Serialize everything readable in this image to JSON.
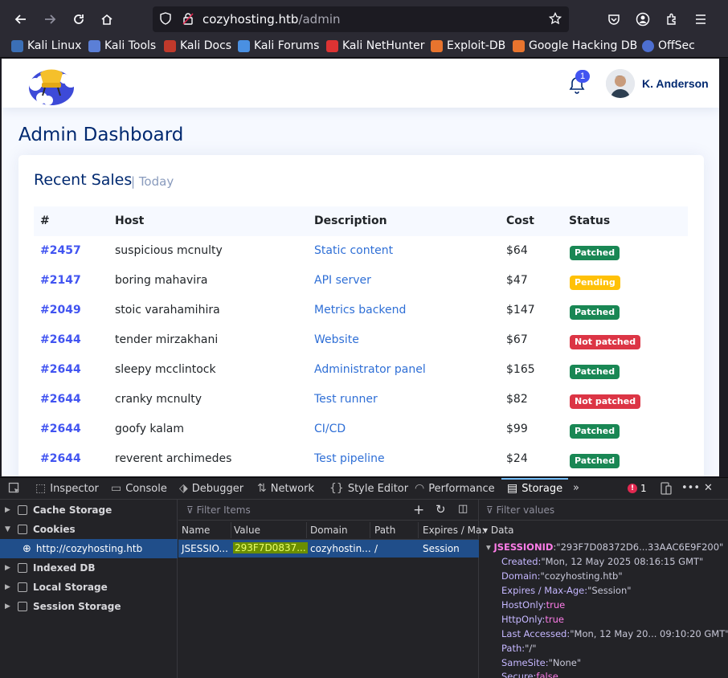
{
  "browser": {
    "url_host": "cozyhosting.htb",
    "url_path": "/admin",
    "bookmarks": [
      "Kali Linux",
      "Kali Tools",
      "Kali Docs",
      "Kali Forums",
      "Kali NetHunter",
      "Exploit-DB",
      "Google Hacking DB",
      "OffSec"
    ]
  },
  "header": {
    "notification_count": "1",
    "user_name": "K. Anderson"
  },
  "page": {
    "title": "Admin Dashboard",
    "card_title": "Recent Sales",
    "card_subtitle": "| Today",
    "columns": [
      "#",
      "Host",
      "Description",
      "Cost",
      "Status"
    ],
    "rows": [
      {
        "id": "#2457",
        "host": "suspicious mcnulty",
        "desc": "Static content",
        "cost": "$64",
        "status": "Patched",
        "kind": "patched"
      },
      {
        "id": "#2147",
        "host": "boring mahavira",
        "desc": "API server",
        "cost": "$47",
        "status": "Pending",
        "kind": "pending"
      },
      {
        "id": "#2049",
        "host": "stoic varahamihira",
        "desc": "Metrics backend",
        "cost": "$147",
        "status": "Patched",
        "kind": "patched"
      },
      {
        "id": "#2644",
        "host": "tender mirzakhani",
        "desc": "Website",
        "cost": "$67",
        "status": "Not patched",
        "kind": "notpatched"
      },
      {
        "id": "#2644",
        "host": "sleepy mcclintock",
        "desc": "Administrator panel",
        "cost": "$165",
        "status": "Patched",
        "kind": "patched"
      },
      {
        "id": "#2644",
        "host": "cranky mcnulty",
        "desc": "Test runner",
        "cost": "$82",
        "status": "Not patched",
        "kind": "notpatched"
      },
      {
        "id": "#2644",
        "host": "goofy kalam",
        "desc": "CI/CD",
        "cost": "$99",
        "status": "Patched",
        "kind": "patched"
      },
      {
        "id": "#2644",
        "host": "reverent archimedes",
        "desc": "Test pipeline",
        "cost": "$24",
        "status": "Patched",
        "kind": "patched"
      }
    ],
    "colors": {
      "patched": "#198754",
      "pending": "#ffc107",
      "notpatched": "#dc3545",
      "accent": "#4154f1",
      "title": "#012970"
    }
  },
  "devtools": {
    "tabs": [
      "Inspector",
      "Console",
      "Debugger",
      "Network",
      "Style Editor",
      "Performance",
      "Storage"
    ],
    "active_tab": "Storage",
    "error_count": "1",
    "tree": {
      "cache_storage": "Cache Storage",
      "cookies": "Cookies",
      "cookie_host": "http://cozyhosting.htb",
      "indexed_db": "Indexed DB",
      "local_storage": "Local Storage",
      "session_storage": "Session Storage"
    },
    "filter_items": "Filter Items",
    "filter_values": "Filter values",
    "cookie_columns": {
      "name": "Name",
      "value": "Value",
      "domain": "Domain",
      "path": "Path",
      "expires": "Expires / Ma:"
    },
    "cookie_row": {
      "name": "JSESSIO...",
      "value": "293F7D0837...",
      "domain": "cozyhostin...",
      "path": "/",
      "expires": "Session"
    },
    "data_header": "Data",
    "data": {
      "key": "JSESSIONID",
      "value": "\"293F7D08372D6...33AAC6E9F200\"",
      "created_k": "Created:",
      "created_v": "\"Mon, 12 May 2025 08:16:15 GMT\"",
      "domain_k": "Domain:",
      "domain_v": "\"cozyhosting.htb\"",
      "expires_k": "Expires / Max-Age:",
      "expires_v": "\"Session\"",
      "hostonly_k": "HostOnly:",
      "hostonly_v": "true",
      "httponly_k": "HttpOnly:",
      "httponly_v": "true",
      "accessed_k": "Last Accessed:",
      "accessed_v": "\"Mon, 12 May 20... 09:10:20 GMT\"",
      "path_k": "Path:",
      "path_v": "\"/\"",
      "samesite_k": "SameSite:",
      "samesite_v": "\"None\"",
      "secure_k": "Secure:",
      "secure_v": "false"
    }
  }
}
